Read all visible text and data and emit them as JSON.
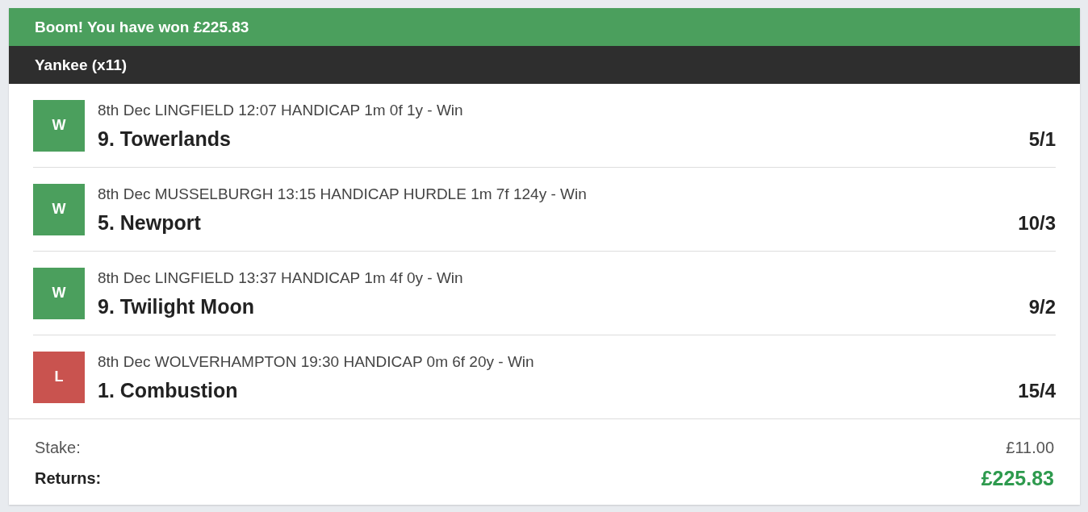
{
  "banner": "Boom! You have won £225.83",
  "bet_type": "Yankee (x11)",
  "selections": [
    {
      "badge": "W",
      "won": true,
      "race": "8th Dec LINGFIELD 12:07 HANDICAP 1m 0f 1y - Win",
      "runner": "9. Towerlands",
      "odds": "5/1"
    },
    {
      "badge": "W",
      "won": true,
      "race": "8th Dec MUSSELBURGH 13:15 HANDICAP HURDLE 1m 7f 124y - Win",
      "runner": "5. Newport",
      "odds": "10/3"
    },
    {
      "badge": "W",
      "won": true,
      "race": "8th Dec LINGFIELD 13:37 HANDICAP 1m 4f 0y - Win",
      "runner": "9. Twilight Moon",
      "odds": "9/2"
    },
    {
      "badge": "L",
      "won": false,
      "race": "8th Dec WOLVERHAMPTON 19:30 HANDICAP 0m 6f 20y - Win",
      "runner": "1. Combustion",
      "odds": "15/4"
    }
  ],
  "summary": {
    "stake_label": "Stake:",
    "stake": "£11.00",
    "returns_label": "Returns:",
    "returns": "£225.83"
  }
}
